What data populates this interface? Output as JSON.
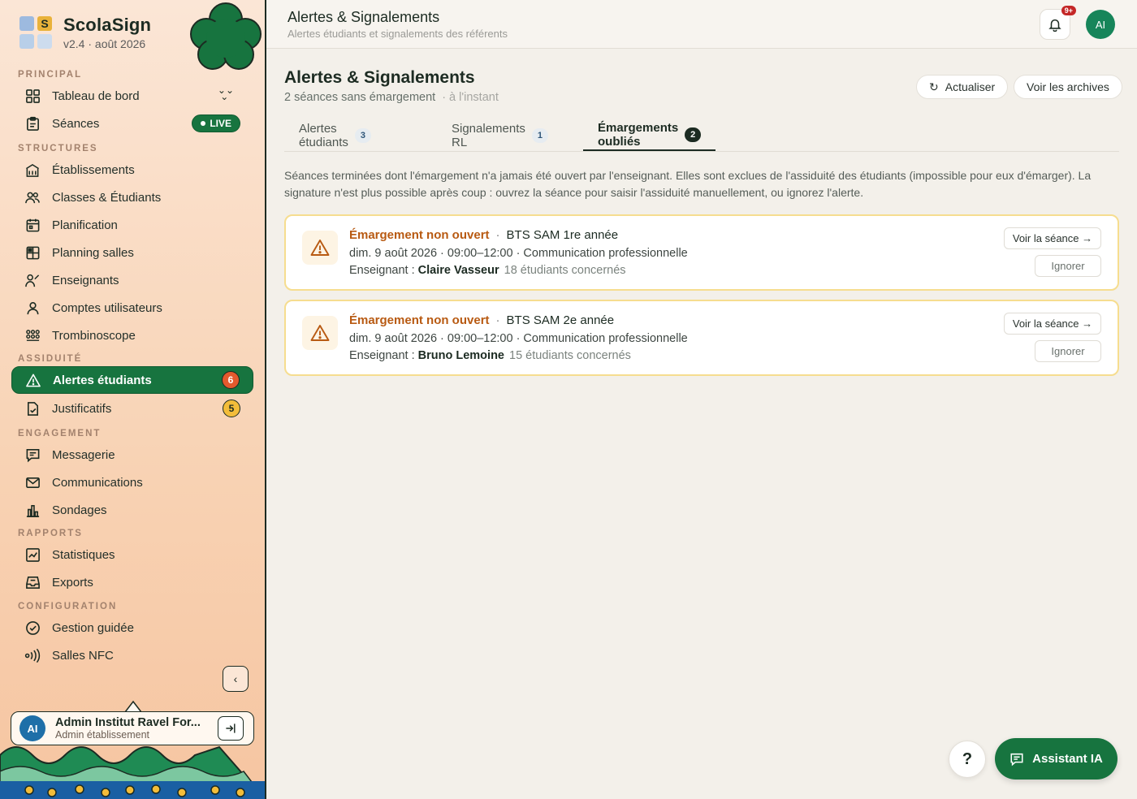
{
  "brand": {
    "name": "ScolaSign",
    "version": "v2.4 · août 2026",
    "logo_letter": "S"
  },
  "sidebar": {
    "sections": {
      "principal": "PRINCIPAL",
      "structures": "STRUCTURES",
      "assiduite": "ASSIDUITÉ",
      "engagement": "ENGAGEMENT",
      "rapports": "RAPPORTS",
      "configuration": "CONFIGURATION"
    },
    "items": {
      "dashboard": "Tableau de bord",
      "seances": "Séances",
      "live": "LIVE",
      "etablissements": "Établissements",
      "classes": "Classes & Étudiants",
      "planification": "Planification",
      "planning_salles": "Planning salles",
      "enseignants": "Enseignants",
      "comptes": "Comptes utilisateurs",
      "trombinoscope": "Trombinoscope",
      "alertes": "Alertes étudiants",
      "alertes_count": "6",
      "justificatifs": "Justificatifs",
      "justificatifs_count": "5",
      "messagerie": "Messagerie",
      "communications": "Communications",
      "sondages": "Sondages",
      "statistiques": "Statistiques",
      "exports": "Exports",
      "gestion_guidee": "Gestion guidée",
      "salles_nfc": "Salles NFC"
    },
    "user": {
      "initials": "AI",
      "name": "Admin Institut Ravel For...",
      "role": "Admin établissement"
    }
  },
  "topbar": {
    "title": "Alertes & Signalements",
    "subtitle": "Alertes étudiants et signalements des référents",
    "notif_badge": "9+",
    "avatar": "AI"
  },
  "main": {
    "title": "Alertes & Signalements",
    "subtitle": "2 séances sans émargement",
    "updated": "· à l'instant",
    "refresh_label": "Actualiser",
    "archives_label": "Voir les archives",
    "tabs": [
      {
        "label": "Alertes étudiants",
        "count": "3"
      },
      {
        "label": "Signalements RL",
        "count": "1"
      },
      {
        "label": "Émargements oubliés",
        "count": "2"
      }
    ],
    "description": "Séances terminées dont l'émargement n'a jamais été ouvert par l'enseignant. Elles sont exclues de l'assiduité des étudiants (impossible pour eux d'émarger). La signature n'est plus possible après coup : ouvrez la séance pour saisir l'assiduité manuellement, ou ignorez l'alerte.",
    "alerts": [
      {
        "title": "Émargement non ouvert",
        "class": "BTS SAM 1re année",
        "details": "dim. 9 août 2026 · 09:00–12:00 · Communication professionnelle",
        "teacher_label": "Enseignant :",
        "teacher": "Claire Vasseur",
        "concerned": "18 étudiants concernés",
        "view_label": "Voir la séance →",
        "ignore_label": "Ignorer"
      },
      {
        "title": "Émargement non ouvert",
        "class": "BTS SAM 2e année",
        "details": "dim. 9 août 2026 · 09:00–12:00 · Communication professionnelle",
        "teacher_label": "Enseignant :",
        "teacher": "Bruno Lemoine",
        "concerned": "15 étudiants concernés",
        "view_label": "Voir la séance →",
        "ignore_label": "Ignorer"
      }
    ]
  },
  "floating": {
    "help": "?",
    "assistant": "Assistant IA"
  },
  "colors": {
    "primary": "#17743f",
    "alert_title": "#b85a12",
    "alert_border": "#f6dd8f",
    "badge_red": "#e35a2e"
  }
}
